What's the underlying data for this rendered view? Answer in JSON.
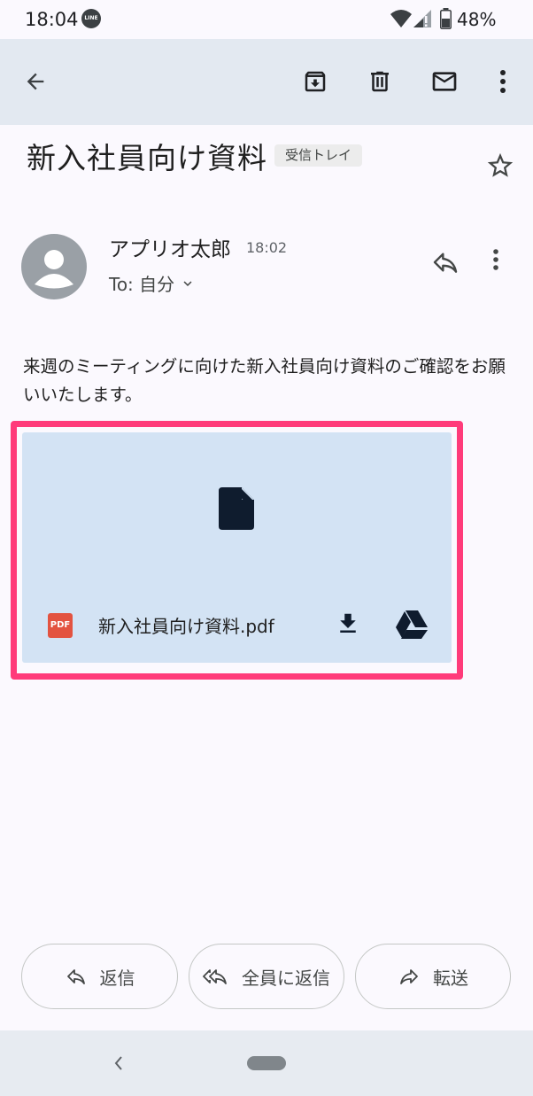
{
  "status_bar": {
    "time": "18:04",
    "line_icon_label": "LINE",
    "battery": "48%"
  },
  "subject": {
    "title": "新入社員向け資料",
    "label": "受信トレイ"
  },
  "message": {
    "sender": "アプリオ太郎",
    "time": "18:02",
    "to": "To: 自分",
    "body": "来週のミーティングに向けた新入社員向け資料のご確認をお願いいたします。"
  },
  "attachment": {
    "type_badge": "PDF",
    "filename": "新入社員向け資料.pdf"
  },
  "actions": {
    "reply": "返信",
    "reply_all": "全員に返信",
    "forward": "転送"
  },
  "colors": {
    "highlight": "#ff3b7a",
    "attachment_bg": "#d3e3f4",
    "toolbar_bg": "#e3e9f1",
    "pdf_red": "#e35340"
  }
}
